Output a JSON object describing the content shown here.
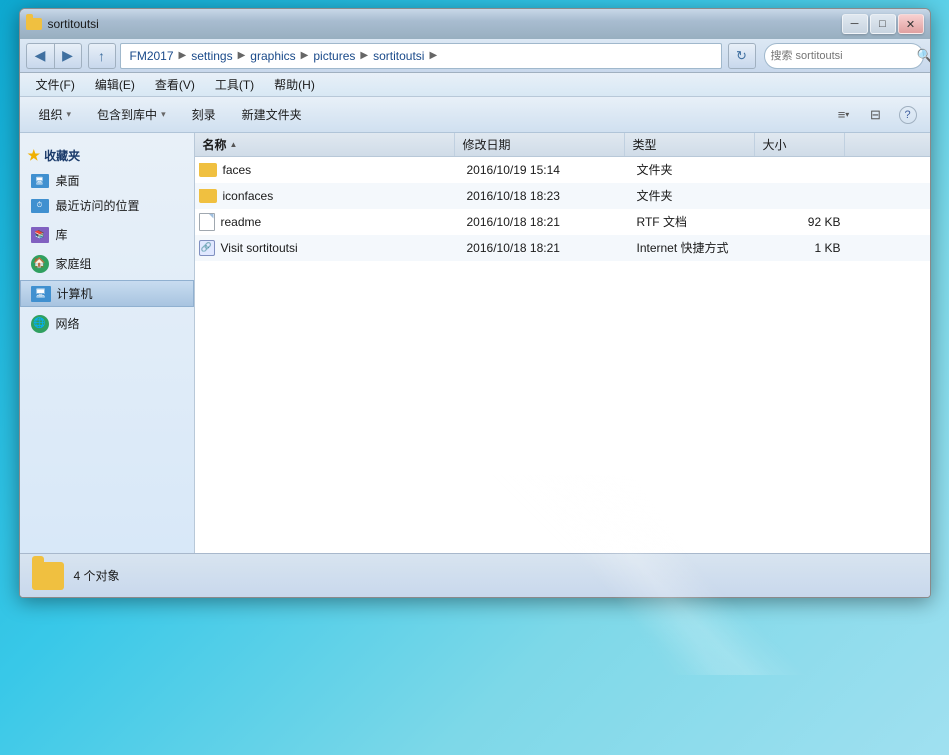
{
  "window": {
    "title": "sortitoutsi",
    "icon": "folder"
  },
  "titlebar": {
    "minimize_label": "─",
    "maximize_label": "□",
    "close_label": "✕"
  },
  "addressbar": {
    "back_label": "◀",
    "forward_label": "▶",
    "up_label": "↑",
    "path": [
      {
        "label": "FM2017"
      },
      {
        "label": "settings"
      },
      {
        "label": "graphics"
      },
      {
        "label": "pictures"
      },
      {
        "label": "sortitoutsi"
      }
    ],
    "dropdown_label": "▾",
    "refresh_label": "↻",
    "search_placeholder": "搜索 sortitoutsi",
    "search_icon": "🔍"
  },
  "menubar": {
    "items": [
      {
        "label": "文件(F)"
      },
      {
        "label": "编辑(E)"
      },
      {
        "label": "查看(V)"
      },
      {
        "label": "工具(T)"
      },
      {
        "label": "帮助(H)"
      }
    ]
  },
  "toolbar": {
    "organize_label": "组织",
    "organize_arrow": "▾",
    "include_label": "包含到库中",
    "include_arrow": "▾",
    "burn_label": "刻录",
    "new_folder_label": "新建文件夹",
    "view_icon": "≡",
    "view_arrow": "▾",
    "pane_icon": "⊞",
    "help_icon": "?"
  },
  "sidebar": {
    "favorites_label": "收藏夹",
    "desktop_label": "桌面",
    "recent_label": "最近访问的位置",
    "library_label": "库",
    "homegroup_label": "家庭组",
    "computer_label": "计算机",
    "network_label": "网络"
  },
  "columns": {
    "name_label": "名称",
    "date_label": "修改日期",
    "type_label": "类型",
    "size_label": "大小",
    "sort_arrow": "▲"
  },
  "files": [
    {
      "name": "faces",
      "type_icon": "folder",
      "date": "2016/10/19 15:14",
      "file_type": "文件夹",
      "size": ""
    },
    {
      "name": "iconfaces",
      "type_icon": "folder",
      "date": "2016/10/18 18:23",
      "file_type": "文件夹",
      "size": ""
    },
    {
      "name": "readme",
      "type_icon": "doc",
      "date": "2016/10/18 18:21",
      "file_type": "RTF 文档",
      "size": "92 KB"
    },
    {
      "name": "Visit sortitoutsi",
      "type_icon": "url",
      "date": "2016/10/18 18:21",
      "file_type": "Internet 快捷方式",
      "size": "1 KB"
    }
  ],
  "statusbar": {
    "count_label": "4 个对象"
  }
}
